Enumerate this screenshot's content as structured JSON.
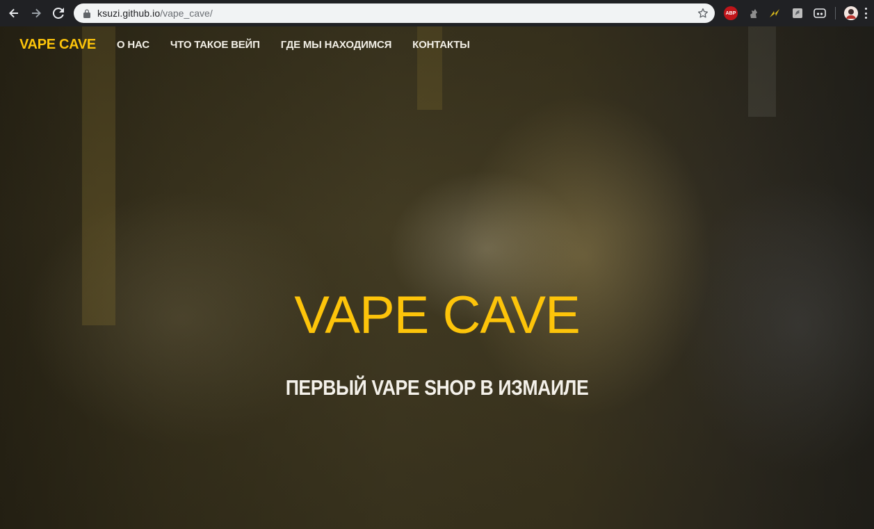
{
  "browser": {
    "url_host": "ksuzi.github.io",
    "url_path": "/vape_cave/",
    "extensions": [
      "adblock-plus-icon",
      "extension-icon",
      "extension-icon",
      "extension-icon",
      "extension-icon",
      "profile-avatar"
    ],
    "abp_label": "ABP"
  },
  "site": {
    "brand": "VAPE CAVE",
    "nav": [
      {
        "label": "О НАС"
      },
      {
        "label": "ЧТО ТАКОЕ ВЕЙП"
      },
      {
        "label": "ГДЕ МЫ НАХОДИМСЯ"
      },
      {
        "label": "КОНТАКТЫ"
      }
    ],
    "accent_color": "#fdc40a"
  },
  "hero": {
    "title": "VAPE CAVE",
    "subtitle": "ПЕРВЫЙ VAPE SHOP В ИЗМАИЛЕ"
  }
}
